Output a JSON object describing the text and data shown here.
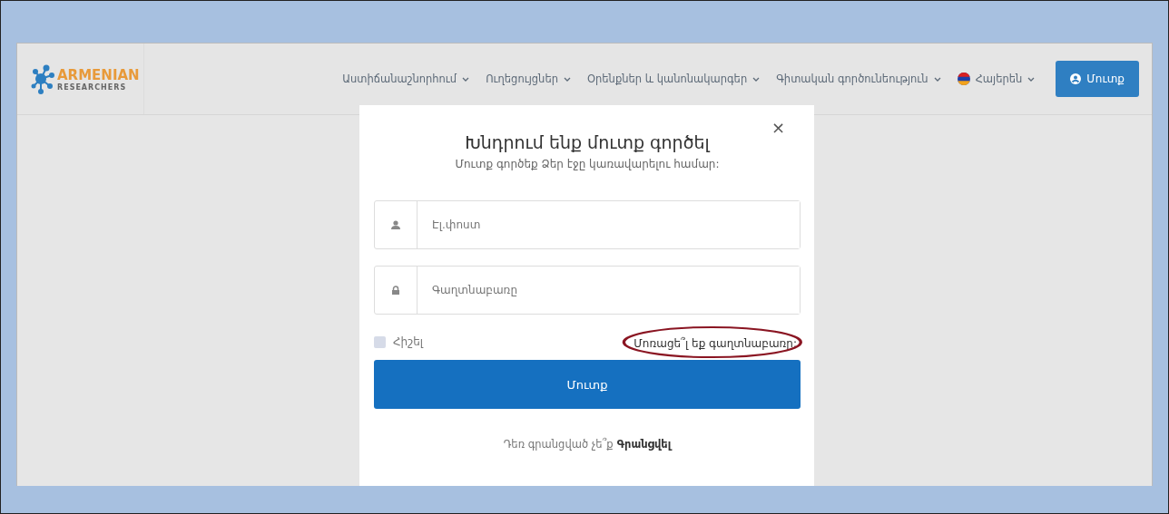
{
  "logo": {
    "title": "ARMENIAN",
    "subtitle": "RESEARCHERS"
  },
  "nav": {
    "items": [
      {
        "label": "Աստիճանաշնորհում"
      },
      {
        "label": "Ուղեցույցներ"
      },
      {
        "label": "Օրենքներ և կանոնակարգեր"
      },
      {
        "label": "Գիտական գործունեություն"
      }
    ],
    "language": "Հայերեն",
    "login_button": "Մուտք"
  },
  "modal": {
    "close": "×",
    "title": "Խնդրում ենք մուտք գործել",
    "subtitle": "Մուտք գործեք Ձեր էջը կառավարելու համար:",
    "email": {
      "placeholder": "Էլ.փոստ"
    },
    "password": {
      "placeholder": "Գաղտնաբառը"
    },
    "remember": {
      "label": "Հիշել",
      "checked": false
    },
    "forgot_link": "Մոռացե՞լ եք գաղտնաբառը:",
    "forgot_circled": true,
    "submit": "Մուտք",
    "signup_text": "Դեռ գրանցված չե՞ք",
    "signup_link": "Գրանցվել"
  }
}
